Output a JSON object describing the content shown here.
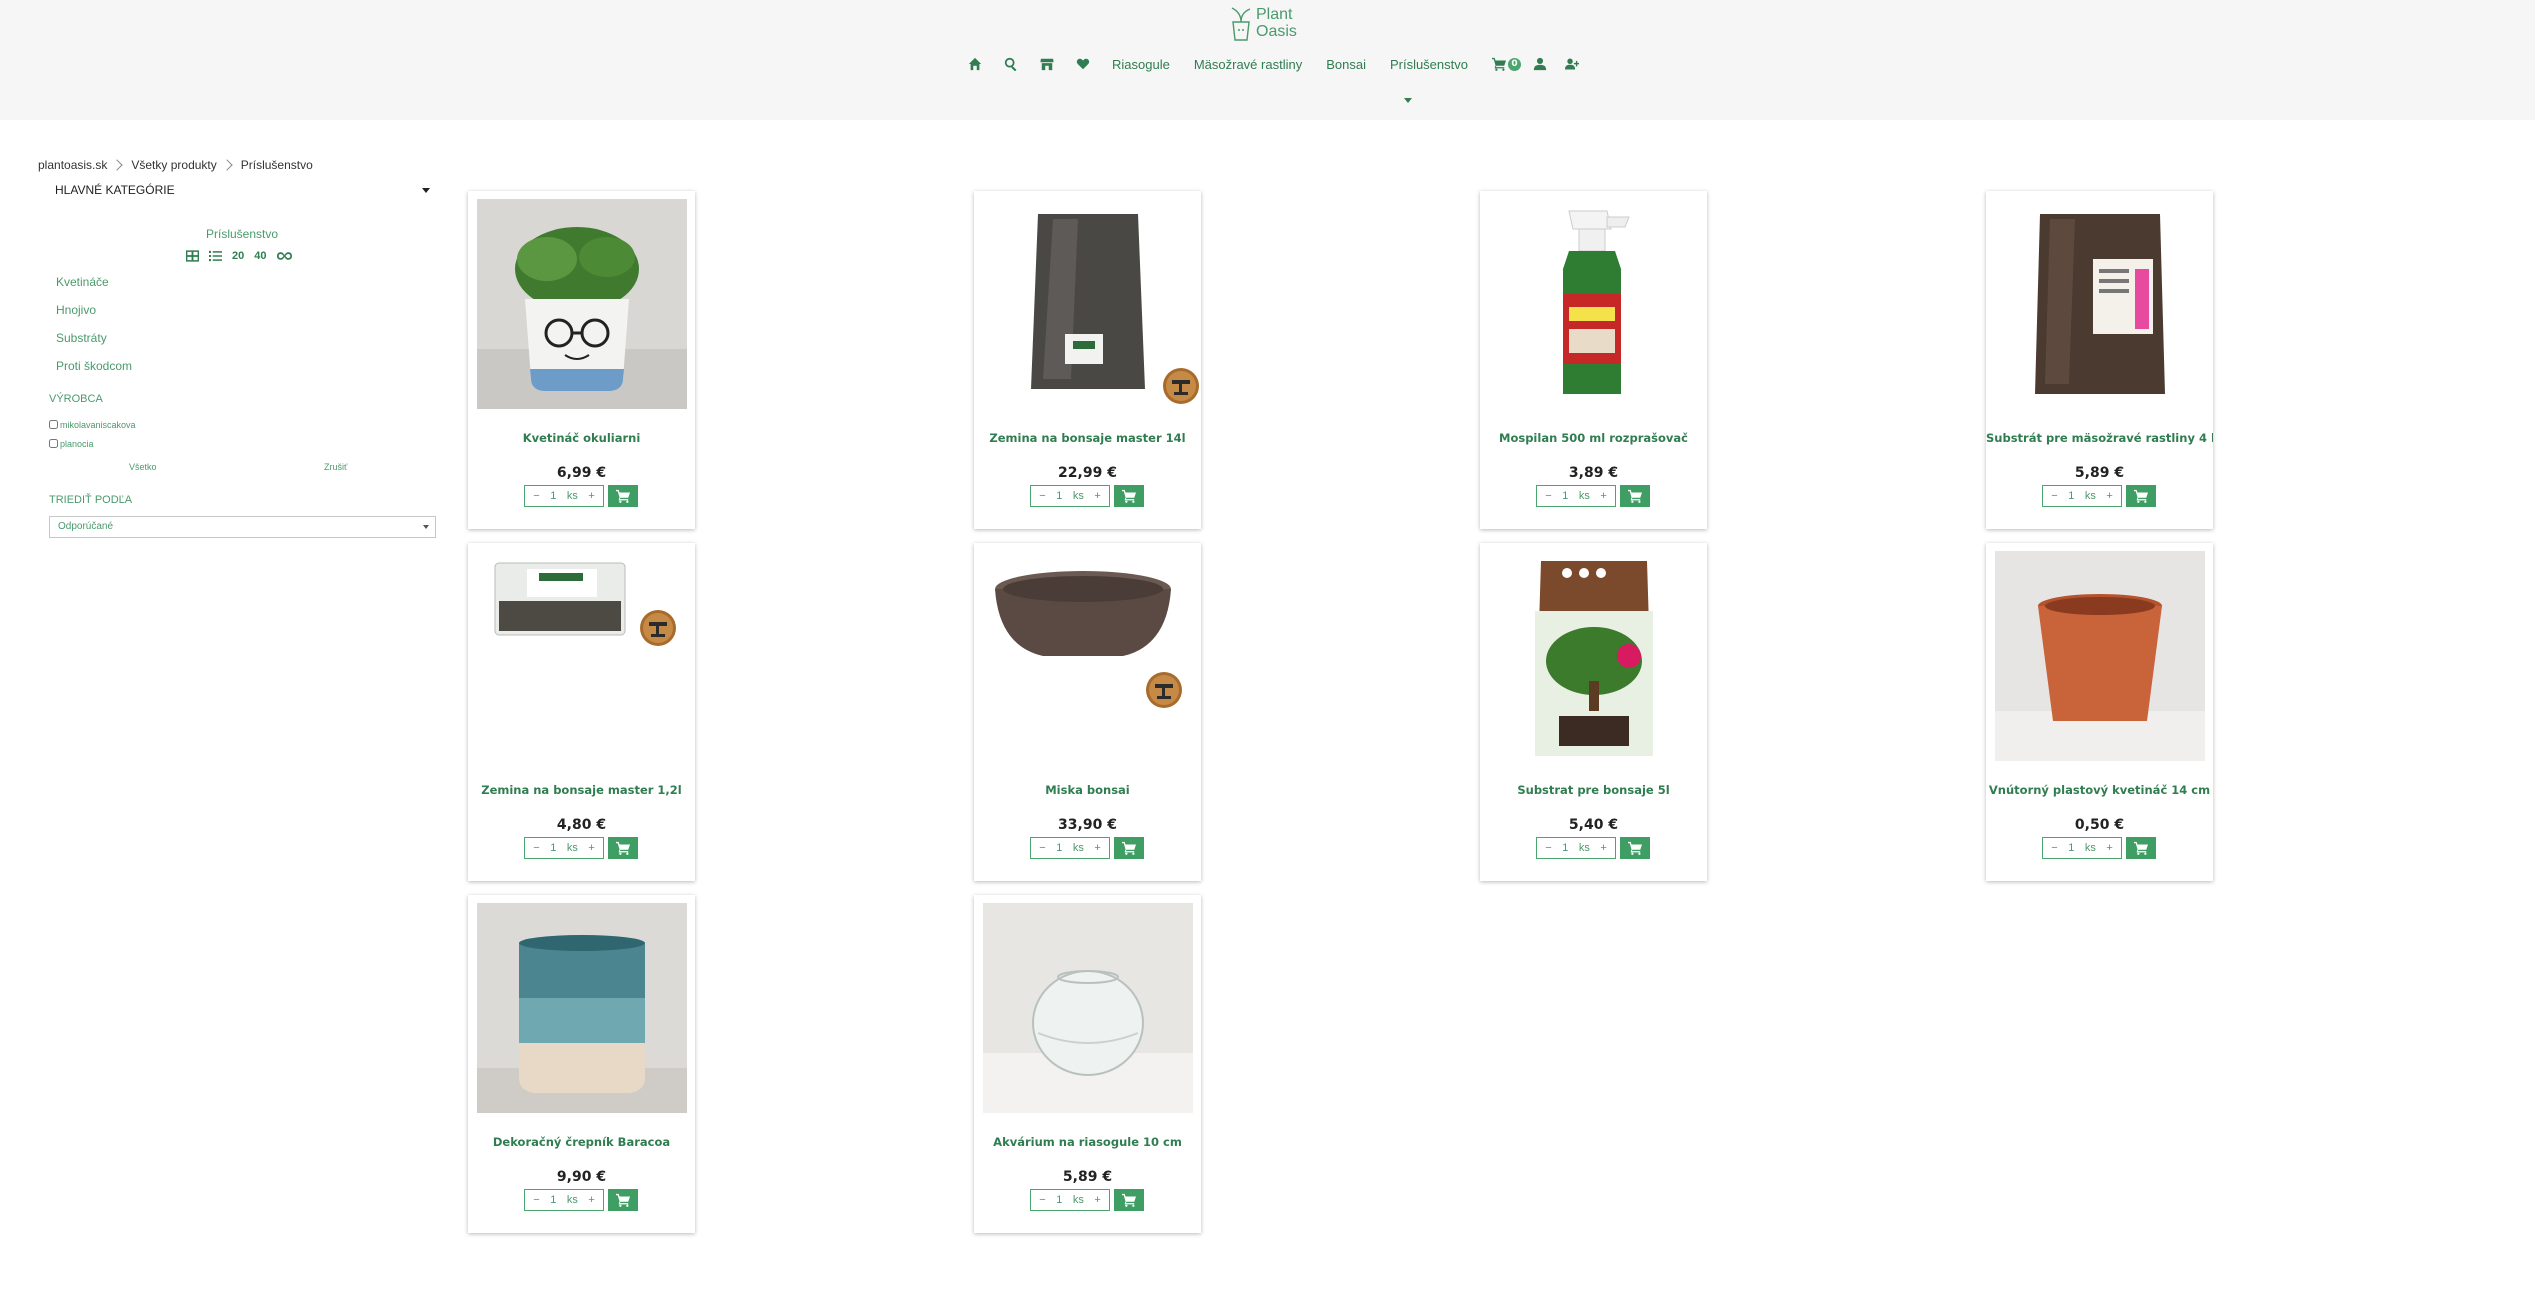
{
  "header": {
    "logo_line1": "Plant",
    "logo_line2": "Oasis",
    "nav_links": [
      "Riasogule",
      "Mäsožravé rastliny",
      "Bonsai",
      "Príslušenstvo"
    ],
    "cart_count": "0",
    "icons": [
      "home-icon",
      "search-icon",
      "store-icon",
      "heart-icon",
      "cart-icon",
      "user-icon",
      "user-plus-icon",
      "chevron-down-icon"
    ]
  },
  "breadcrumb": [
    "plantoasis.sk",
    "Všetky produkty",
    "Príslušenstvo"
  ],
  "sidebar": {
    "main_categories_label": "HLAVNÉ KATEGÓRIE",
    "current_category": "Príslušenstvo",
    "page_sizes": [
      "20",
      "40"
    ],
    "subcategories": [
      "Kvetináče",
      "Hnojivo",
      "Substráty",
      "Proti škodcom"
    ],
    "brand_title": "VÝROBCA",
    "brands": [
      "mikolavaniscakova",
      "planocia"
    ],
    "brand_all": "Všetko",
    "brand_clear": "Zrušiť",
    "sort_title": "TRIEDIŤ PODĽA",
    "sort_value": "Odporúčané"
  },
  "products": [
    {
      "name": "Kvetináč okuliarni",
      "price": "6,99 €",
      "qty": "1",
      "unit": "ks"
    },
    {
      "name": "Zemina na bonsaje master 14l",
      "price": "22,99 €",
      "qty": "1",
      "unit": "ks"
    },
    {
      "name": "Mospilan 500 ml rozprašovač",
      "price": "3,89 €",
      "qty": "1",
      "unit": "ks"
    },
    {
      "name": "Substrát pre mäsožravé rastliny 4 l",
      "price": "5,89 €",
      "qty": "1",
      "unit": "ks"
    },
    {
      "name": "Zemina na bonsaje master 1,2l",
      "price": "4,80 €",
      "qty": "1",
      "unit": "ks"
    },
    {
      "name": "Miska bonsai",
      "price": "33,90 €",
      "qty": "1",
      "unit": "ks"
    },
    {
      "name": "Substrat pre bonsaje 5l",
      "price": "5,40 €",
      "qty": "1",
      "unit": "ks"
    },
    {
      "name": "Vnútorný plastový kvetináč 14 cm",
      "price": "0,50 €",
      "qty": "1",
      "unit": "ks"
    },
    {
      "name": "Dekoračný črepník Baracoa",
      "price": "9,90 €",
      "qty": "1",
      "unit": "ks"
    },
    {
      "name": "Akvárium na riasogule 10 cm",
      "price": "5,89 €",
      "qty": "1",
      "unit": "ks"
    }
  ],
  "colors": {
    "brand_green": "#2f7d50",
    "button_green": "#3e9e64",
    "header_bg": "#f6f6f6"
  }
}
